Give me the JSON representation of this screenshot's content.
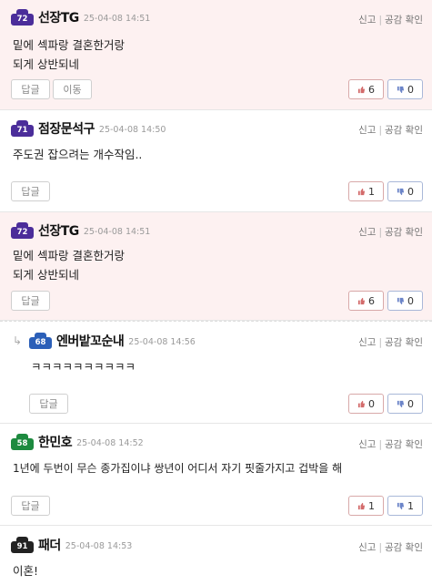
{
  "comments": [
    {
      "nick": "선장TG",
      "level": "72",
      "time": "25-04-08 14:51",
      "lines": [
        "밑에 섹파랑 결혼한거랑",
        "되게 상반되네"
      ],
      "up": "6",
      "down": "0"
    },
    {
      "nick": "점장문석구",
      "level": "71",
      "time": "25-04-08 14:50",
      "lines": [
        "주도권 잡으려는 개수작임.."
      ],
      "up": "1",
      "down": "0"
    },
    {
      "nick": "선장TG",
      "level": "72",
      "time": "25-04-08 14:51",
      "lines": [
        "밑에 섹파랑 결혼한거랑",
        "되게 상반되네"
      ],
      "up": "6",
      "down": "0"
    },
    {
      "nick": "엔버밭꼬순내",
      "level": "68",
      "time": "25-04-08 14:56",
      "lines": [
        "ㅋㅋㅋㅋㅋㅋㅋㅋㅋㅋ"
      ],
      "up": "0",
      "down": "0"
    },
    {
      "nick": "한민호",
      "level": "58",
      "time": "25-04-08 14:52",
      "lines": [
        "1년에 두번이 무슨 종가집이냐 쌍년이 어디서 자기 핏줄가지고 겁박을 해"
      ],
      "up": "1",
      "down": "1"
    },
    {
      "nick": "패더",
      "level": "91",
      "time": "25-04-08 14:53",
      "lines": [
        "이혼!"
      ]
    }
  ],
  "labels": {
    "report": "신고",
    "sep": "|",
    "like": "공감 확인",
    "reply": "답글",
    "move": "이동",
    "reply_arrow": "↳"
  },
  "colors": {
    "highlight_bg": "#fdf1f1",
    "up_border": "#d8a9a9",
    "down_border": "#a9b8d8"
  }
}
